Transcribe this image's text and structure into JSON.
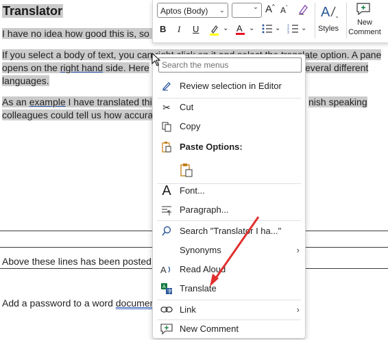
{
  "document": {
    "title": "Translator",
    "p1": "I have no idea how good this is, so I",
    "p2a": "If you select a body of text, you can right click on it and select the translate option.  A pane",
    "p2b_pre": "opens on the ",
    "p2b_link": "right hand",
    "p2b_post": " side.  Here",
    "p2b_tail": "everal different",
    "p2c": "languages.",
    "p3a_pre": "As an ",
    "p3a_link": "example",
    "p3a_post": " I have translated thi",
    "p3a_tail": "nish speaking",
    "p3b": "colleagues could tell us how accura",
    "p4": "Above these lines has been posted",
    "p5_pre": "Add a password to a word ",
    "p5_link": "documen"
  },
  "toolbar": {
    "font_name": "Aptos (Body)",
    "font_size": "",
    "grow_font": "A",
    "shrink_font": "A",
    "bold": "B",
    "italic": "I",
    "underline": "U",
    "styles_label": "Styles",
    "new_comment_line1": "New",
    "new_comment_line2": "Comment"
  },
  "menu": {
    "search_placeholder": "Search the menus",
    "items": [
      {
        "label": "Review selection in Editor"
      },
      {
        "label": "Cut"
      },
      {
        "label": "Copy"
      },
      {
        "label": "Paste Options:"
      },
      {
        "label": "Font..."
      },
      {
        "label": "Paragraph..."
      },
      {
        "label": "Search \"Translator I ha...\""
      },
      {
        "label": "Synonyms"
      },
      {
        "label": "Read Aloud"
      },
      {
        "label": "Translate"
      },
      {
        "label": "Link"
      },
      {
        "label": "New Comment"
      }
    ]
  },
  "colors": {
    "selection": "#cbcbcb",
    "highlight_yellow": "#ffff00",
    "font_red": "#e81123",
    "arrow_red": "#e0302f",
    "link_blue": "#2f5bb7"
  }
}
